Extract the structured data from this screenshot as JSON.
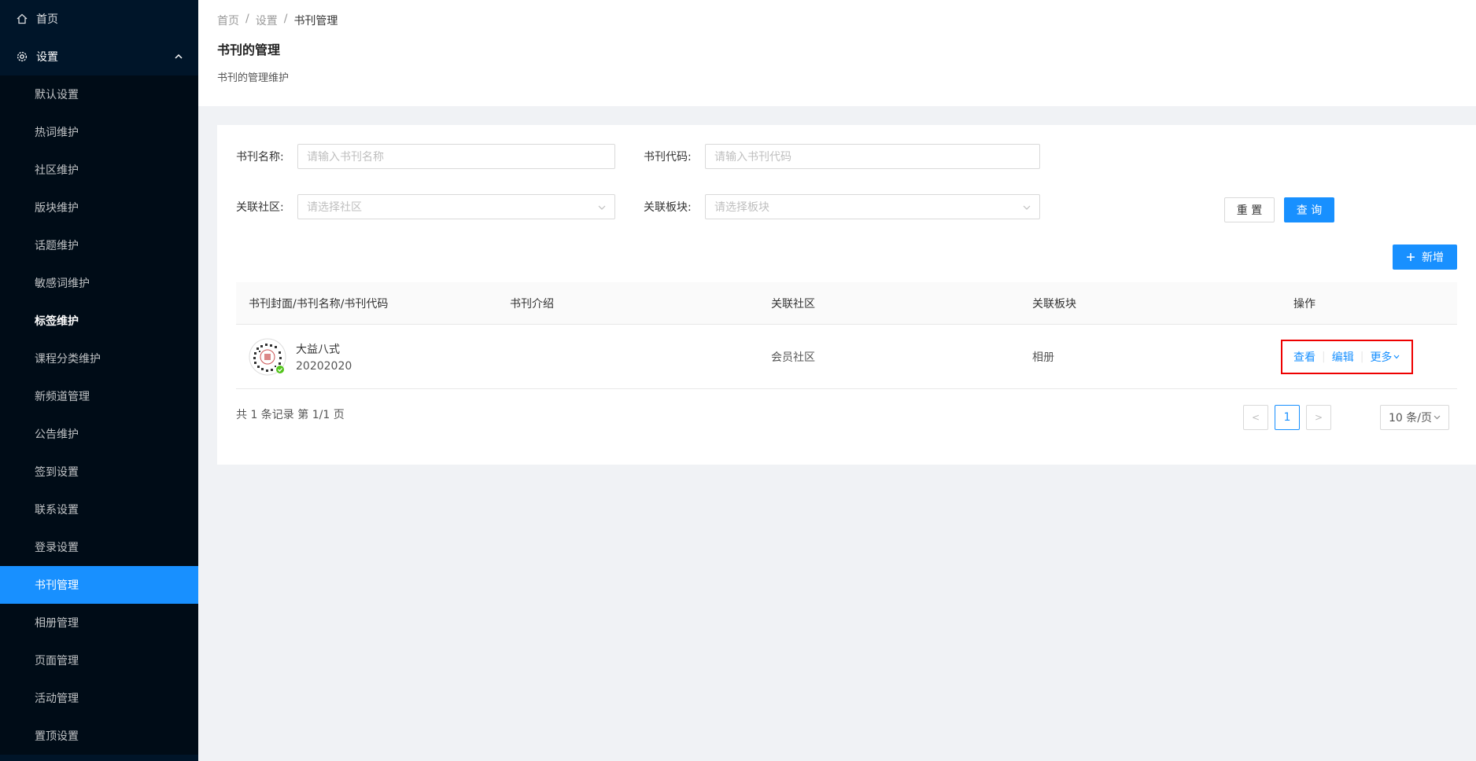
{
  "sidebar": {
    "home_label": "首页",
    "settings_label": "设置",
    "items": [
      {
        "label": "默认设置"
      },
      {
        "label": "热词维护"
      },
      {
        "label": "社区维护"
      },
      {
        "label": "版块维护"
      },
      {
        "label": "话题维护"
      },
      {
        "label": "敏感词维护"
      },
      {
        "label": "标签维护"
      },
      {
        "label": "课程分类维护"
      },
      {
        "label": "新频道管理"
      },
      {
        "label": "公告维护"
      },
      {
        "label": "签到设置"
      },
      {
        "label": "联系设置"
      },
      {
        "label": "登录设置"
      },
      {
        "label": "书刊管理"
      },
      {
        "label": "相册管理"
      },
      {
        "label": "页面管理"
      },
      {
        "label": "活动管理"
      },
      {
        "label": "置顶设置"
      }
    ]
  },
  "breadcrumb": [
    "首页",
    "设置",
    "书刊管理"
  ],
  "page": {
    "title": "书刊的管理",
    "description": "书刊的管理维护"
  },
  "filters": {
    "name_label": "书刊名称:",
    "name_placeholder": "请输入书刊名称",
    "code_label": "书刊代码:",
    "code_placeholder": "请输入书刊代码",
    "community_label": "关联社区:",
    "community_placeholder": "请选择社区",
    "block_label": "关联板块:",
    "block_placeholder": "请选择板块",
    "reset_label": "重 置",
    "query_label": "查 询"
  },
  "add_button": "新增",
  "table": {
    "columns": [
      "书刊封面/书刊名称/书刊代码",
      "书刊介绍",
      "关联社区",
      "关联板块",
      "操作"
    ],
    "rows": [
      {
        "name": "大益八式",
        "code": "20202020",
        "intro": "",
        "community": "会员社区",
        "block": "相册",
        "actions": {
          "view": "查看",
          "edit": "编辑",
          "more": "更多"
        }
      }
    ]
  },
  "pagination": {
    "summary": "共 1 条记录 第 1/1 页",
    "current_page": "1",
    "page_size": "10 条/页",
    "prev": "<",
    "next": ">"
  },
  "colors": {
    "sidebar_bg": "#001529",
    "primary": "#1890ff",
    "highlight_border": "#e00000"
  }
}
